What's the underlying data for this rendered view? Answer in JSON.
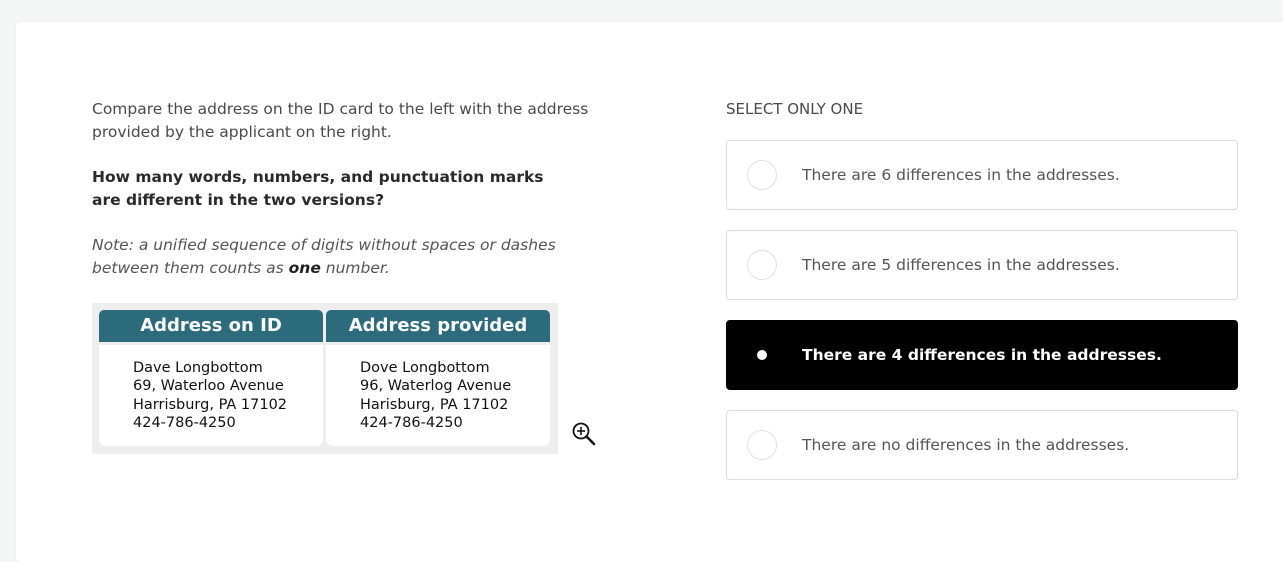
{
  "instructions": {
    "intro": "Compare the address on the ID card to the left with the address provided by the applicant on the right.",
    "question": "How many words, numbers, and punctuation marks are different in the two versions?",
    "note_before": "Note: a unified sequence of digits without spaces or dashes between them counts as ",
    "note_emphasis": "one",
    "note_after": " number."
  },
  "address_table": {
    "col1_header": "Address on ID",
    "col2_header": "Address provided",
    "col1_lines": [
      "Dave Longbottom",
      "69, Waterloo Avenue",
      "Harrisburg, PA 17102",
      "424-786-4250"
    ],
    "col2_lines": [
      "Dove Longbottom",
      "96, Waterlog Avenue",
      "Harisburg, PA 17102",
      "424-786-4250"
    ],
    "header_color": "#2c6b7c"
  },
  "zoom": {
    "icon": "zoom-in-icon"
  },
  "answer": {
    "label": "SELECT ONLY ONE",
    "options": [
      {
        "text": "There are 6 differences in the addresses.",
        "selected": false
      },
      {
        "text": "There are 5 differences in the addresses.",
        "selected": false
      },
      {
        "text": "There are 4 differences in the addresses.",
        "selected": true
      },
      {
        "text": "There are no differences in the addresses.",
        "selected": false
      }
    ],
    "selected_color": "#000000"
  }
}
